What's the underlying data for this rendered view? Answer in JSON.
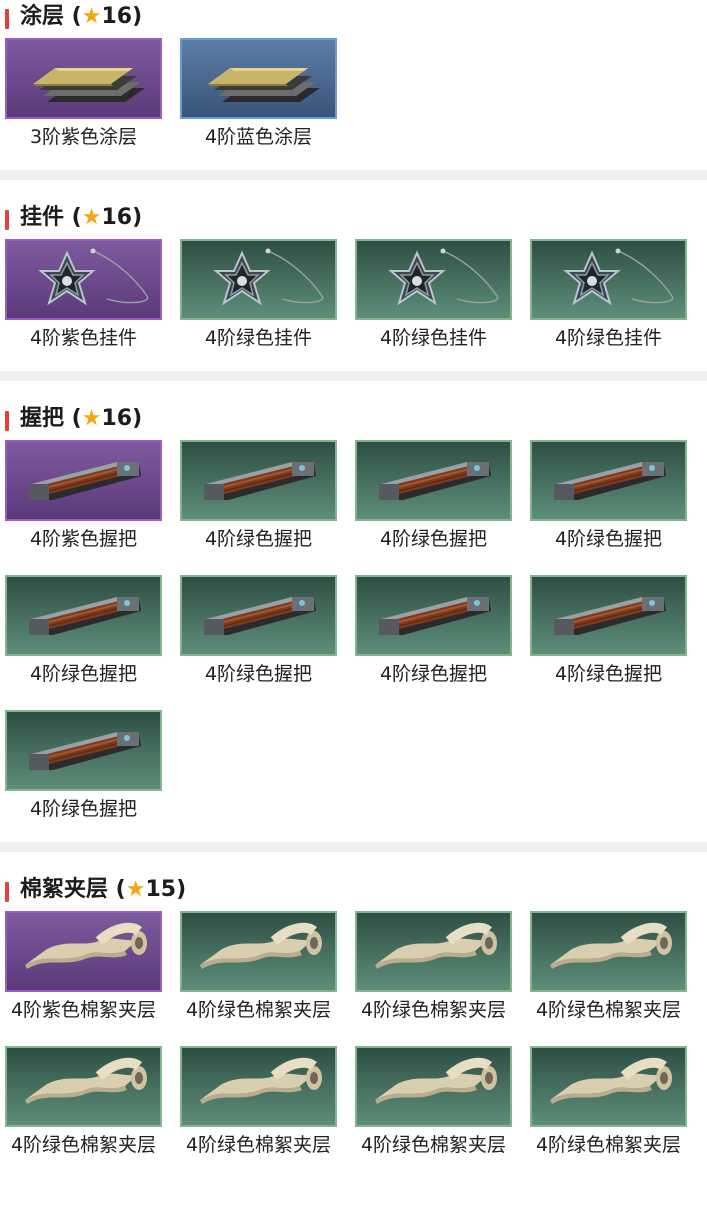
{
  "sections": [
    {
      "title": "涂层",
      "star": "★",
      "score": "16",
      "items": [
        {
          "label": "3阶紫色涂层",
          "rarity": "purple",
          "icon": "coating-sheet-icon"
        },
        {
          "label": "4阶蓝色涂层",
          "rarity": "blue",
          "icon": "coating-sheet-icon"
        }
      ]
    },
    {
      "title": "挂件",
      "star": "★",
      "score": "16",
      "items": [
        {
          "label": "4阶紫色挂件",
          "rarity": "purple",
          "icon": "star-pendant-icon"
        },
        {
          "label": "4阶绿色挂件",
          "rarity": "green",
          "icon": "star-pendant-icon"
        },
        {
          "label": "4阶绿色挂件",
          "rarity": "green",
          "icon": "star-pendant-icon"
        },
        {
          "label": "4阶绿色挂件",
          "rarity": "green",
          "icon": "star-pendant-icon"
        }
      ]
    },
    {
      "title": "握把",
      "star": "★",
      "score": "16",
      "items": [
        {
          "label": "4阶紫色握把",
          "rarity": "purple",
          "icon": "grip-handle-icon"
        },
        {
          "label": "4阶绿色握把",
          "rarity": "green",
          "icon": "grip-handle-icon"
        },
        {
          "label": "4阶绿色握把",
          "rarity": "green",
          "icon": "grip-handle-icon"
        },
        {
          "label": "4阶绿色握把",
          "rarity": "green",
          "icon": "grip-handle-icon"
        },
        {
          "label": "4阶绿色握把",
          "rarity": "green",
          "icon": "grip-handle-icon"
        },
        {
          "label": "4阶绿色握把",
          "rarity": "green",
          "icon": "grip-handle-icon"
        },
        {
          "label": "4阶绿色握把",
          "rarity": "green",
          "icon": "grip-handle-icon"
        },
        {
          "label": "4阶绿色握把",
          "rarity": "green",
          "icon": "grip-handle-icon"
        },
        {
          "label": "4阶绿色握把",
          "rarity": "green",
          "icon": "grip-handle-icon"
        }
      ]
    },
    {
      "title": "棉絮夹层",
      "star": "★",
      "score": "15",
      "items": [
        {
          "label": "4阶紫色棉絮夹层",
          "rarity": "purple",
          "icon": "cotton-roll-icon"
        },
        {
          "label": "4阶绿色棉絮夹层",
          "rarity": "green",
          "icon": "cotton-roll-icon"
        },
        {
          "label": "4阶绿色棉絮夹层",
          "rarity": "green",
          "icon": "cotton-roll-icon"
        },
        {
          "label": "4阶绿色棉絮夹层",
          "rarity": "green",
          "icon": "cotton-roll-icon"
        },
        {
          "label": "4阶绿色棉絮夹层",
          "rarity": "green",
          "icon": "cotton-roll-icon"
        },
        {
          "label": "4阶绿色棉絮夹层",
          "rarity": "green",
          "icon": "cotton-roll-icon"
        },
        {
          "label": "4阶绿色棉絮夹层",
          "rarity": "green",
          "icon": "cotton-roll-icon"
        },
        {
          "label": "4阶绿色棉絮夹层",
          "rarity": "green",
          "icon": "cotton-roll-icon"
        }
      ]
    }
  ],
  "colors": {
    "accent_bar": "#e0413a",
    "star": "#f3a712",
    "purple": "#9a5cc6",
    "blue": "#6b9bd3",
    "green": "#86b38f"
  }
}
